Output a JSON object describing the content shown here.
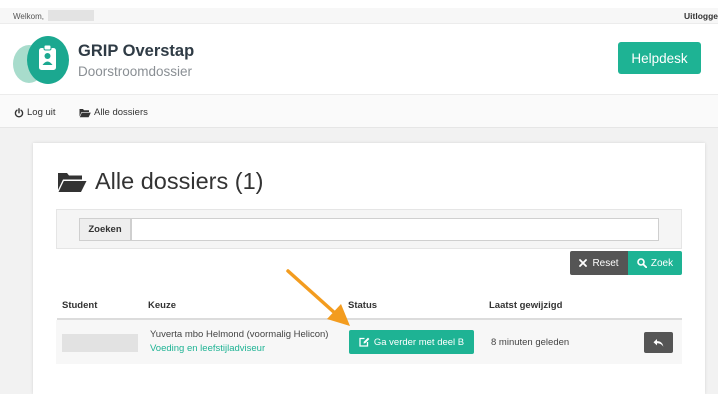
{
  "topbar": {
    "welcome": "Welkom,",
    "logout": "Uitlogge"
  },
  "header": {
    "title": "GRIP Overstap",
    "subtitle": "Doorstroomdossier",
    "helpdesk_label": "Helpdesk"
  },
  "nav": {
    "logout_label": "Log uit",
    "all_dossiers_label": "Alle dossiers"
  },
  "main": {
    "title": "Alle dossiers (1)",
    "search": {
      "label": "Zoeken",
      "value": ""
    },
    "reset_label": "Reset",
    "zoek_label": "Zoek"
  },
  "table": {
    "headers": {
      "student": "Student",
      "keuze": "Keuze",
      "status": "Status",
      "modified": "Laatst gewijzigd"
    },
    "rows": [
      {
        "keuze_school": "Yuverta mbo Helmond (voormalig Helicon)",
        "keuze_opleiding": "Voeding en leefstijladviseur",
        "status_label": "Ga verder met deel B",
        "modified": "8 minuten geleden"
      }
    ]
  },
  "colors": {
    "accent": "#1eb394",
    "dark_button": "#555555",
    "annotation_arrow": "#f39c1f"
  },
  "icons": [
    "power-icon",
    "folder-open-icon",
    "times-icon",
    "search-icon",
    "edit-icon",
    "reply-icon",
    "arrow-annotation"
  ]
}
